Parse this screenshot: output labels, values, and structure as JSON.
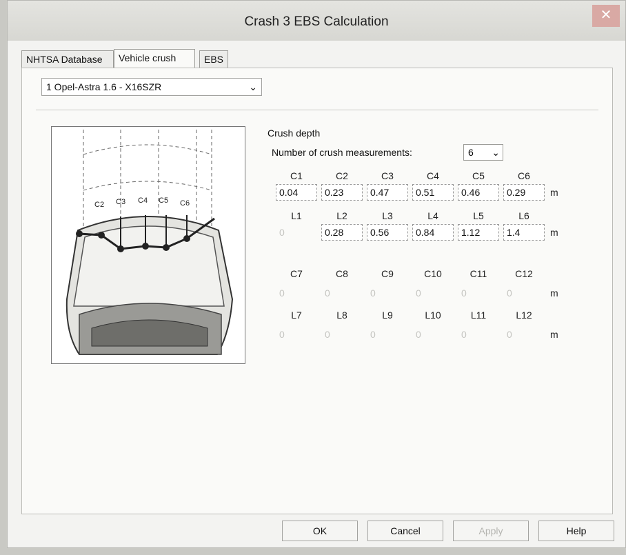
{
  "window": {
    "title": "Crash 3 EBS Calculation",
    "close_glyph": "✕"
  },
  "tabs": [
    {
      "label": "NHTSA Database"
    },
    {
      "label": "Vehicle crush"
    },
    {
      "label": "EBS"
    }
  ],
  "vehicle": {
    "selected": "1 Opel-Astra  1.6 - X16SZR"
  },
  "crush": {
    "section_title": "Crush depth",
    "count_label": "Number of crush measurements:",
    "count_value": "6",
    "unit": "m",
    "figure_labels": [
      "C2",
      "C3",
      "C4",
      "C5",
      "C6"
    ],
    "c_headers_1": [
      "C1",
      "C2",
      "C3",
      "C4",
      "C5",
      "C6"
    ],
    "c_values_1": [
      "0.04",
      "0.23",
      "0.47",
      "0.51",
      "0.46",
      "0.29"
    ],
    "l_headers_1": [
      "L1",
      "L2",
      "L3",
      "L4",
      "L5",
      "L6"
    ],
    "l_values_1": [
      "0",
      "0.28",
      "0.56",
      "0.84",
      "1.12",
      "1.4"
    ],
    "c_headers_2": [
      "C7",
      "C8",
      "C9",
      "C10",
      "C11",
      "C12"
    ],
    "c_values_2": [
      "0",
      "0",
      "0",
      "0",
      "0",
      "0"
    ],
    "l_headers_2": [
      "L7",
      "L8",
      "L9",
      "L10",
      "L11",
      "L12"
    ],
    "l_values_2": [
      "0",
      "0",
      "0",
      "0",
      "0",
      "0"
    ]
  },
  "buttons": {
    "ok": "OK",
    "cancel": "Cancel",
    "apply": "Apply",
    "help": "Help"
  }
}
